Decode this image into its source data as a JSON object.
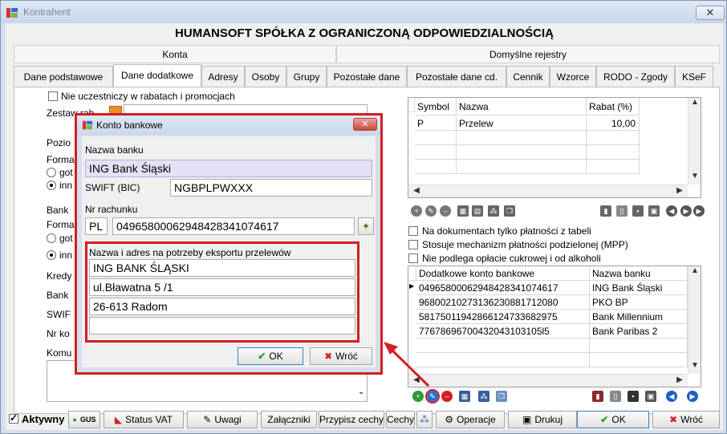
{
  "window": {
    "title": "Kontrahent",
    "close_glyph": "✕"
  },
  "company_name": "HUMANSOFT SPÓŁKA Z OGRANICZONĄ ODPOWIEDZIALNOŚCIĄ",
  "header_tabs": [
    "Konta",
    "Domyślne rejestry"
  ],
  "tabs": [
    {
      "label": "Dane podstawowe"
    },
    {
      "label": "Dane dodatkowe",
      "active": true
    },
    {
      "label": "Adresy"
    },
    {
      "label": "Osoby"
    },
    {
      "label": "Grupy"
    },
    {
      "label": "Pozostałe dane"
    },
    {
      "label": "Pozostałe dane cd."
    },
    {
      "label": "Cennik"
    },
    {
      "label": "Wzorce"
    },
    {
      "label": "RODO - Zgody"
    },
    {
      "label": "KSeF"
    }
  ],
  "left_panel": {
    "no_discount_checkbox": "Nie uczestniczy w rabatach i promocjach",
    "labels": [
      "Zestaw rab...",
      "Pozio",
      "Forma",
      "got",
      "inn",
      "Bank",
      "Forma",
      "got",
      "inn",
      "Kredy",
      "Bank",
      "SWIF",
      "Nr ko",
      "Komu"
    ]
  },
  "discount_grid": {
    "columns": [
      "Symbol",
      "Nazwa",
      "Rabat (%)"
    ],
    "rows": [
      [
        "P",
        "Przelew",
        "10,00"
      ]
    ]
  },
  "payment_options": [
    "Na dokumentach tylko płatności z tabeli",
    "Stosuje mechanizm płatności podzielonej (MPP)",
    "Nie podlega opłacie cukrowej i od alkoholi"
  ],
  "accounts_grid": {
    "columns": [
      "Dodatkowe konto bankowe",
      "Nazwa banku"
    ],
    "rows": [
      [
        "04965800062948428341074617",
        "ING Bank Śląski"
      ],
      [
        "96800210273136230881712080",
        "PKO BP"
      ],
      [
        "58175011942866124733682975",
        "Bank Millennium"
      ],
      [
        "77678696700432043103105l5",
        "Bank Paribas 2"
      ]
    ]
  },
  "bottom_bar": {
    "active_label": "Aktywny",
    "gus_label": "GUS",
    "status_vat": "Status VAT",
    "uwagi": "Uwagi",
    "zalaczniki": "Załączniki",
    "przypisz_cechy": "Przypisz cechy",
    "cechy": "Cechy",
    "operacje": "Operacje",
    "drukuj": "Drukuj",
    "ok": "OK",
    "wroc": "Wróć"
  },
  "dialog": {
    "title": "Konto bankowe",
    "bank_name_label": "Nazwa banku",
    "bank_name_value": "ING Bank Śląski",
    "swift_label": "SWIFT (BIC)",
    "swift_value": "NGBPLPWXXX",
    "account_label": "Nr rachunku",
    "country_code": "PL",
    "account_number": "04965800062948428341074617",
    "export_label": "Nazwa i adres na potrzeby eksportu przelewów",
    "export_lines": [
      "ING BANK ŚLĄSKI",
      "ul.Bławatna 5 /1",
      "26-613 Radom",
      ""
    ],
    "ok": "OK",
    "wroc": "Wróć"
  },
  "colors": {
    "highlight_red": "#d21f25",
    "selected_field": "#e6e0f5"
  }
}
